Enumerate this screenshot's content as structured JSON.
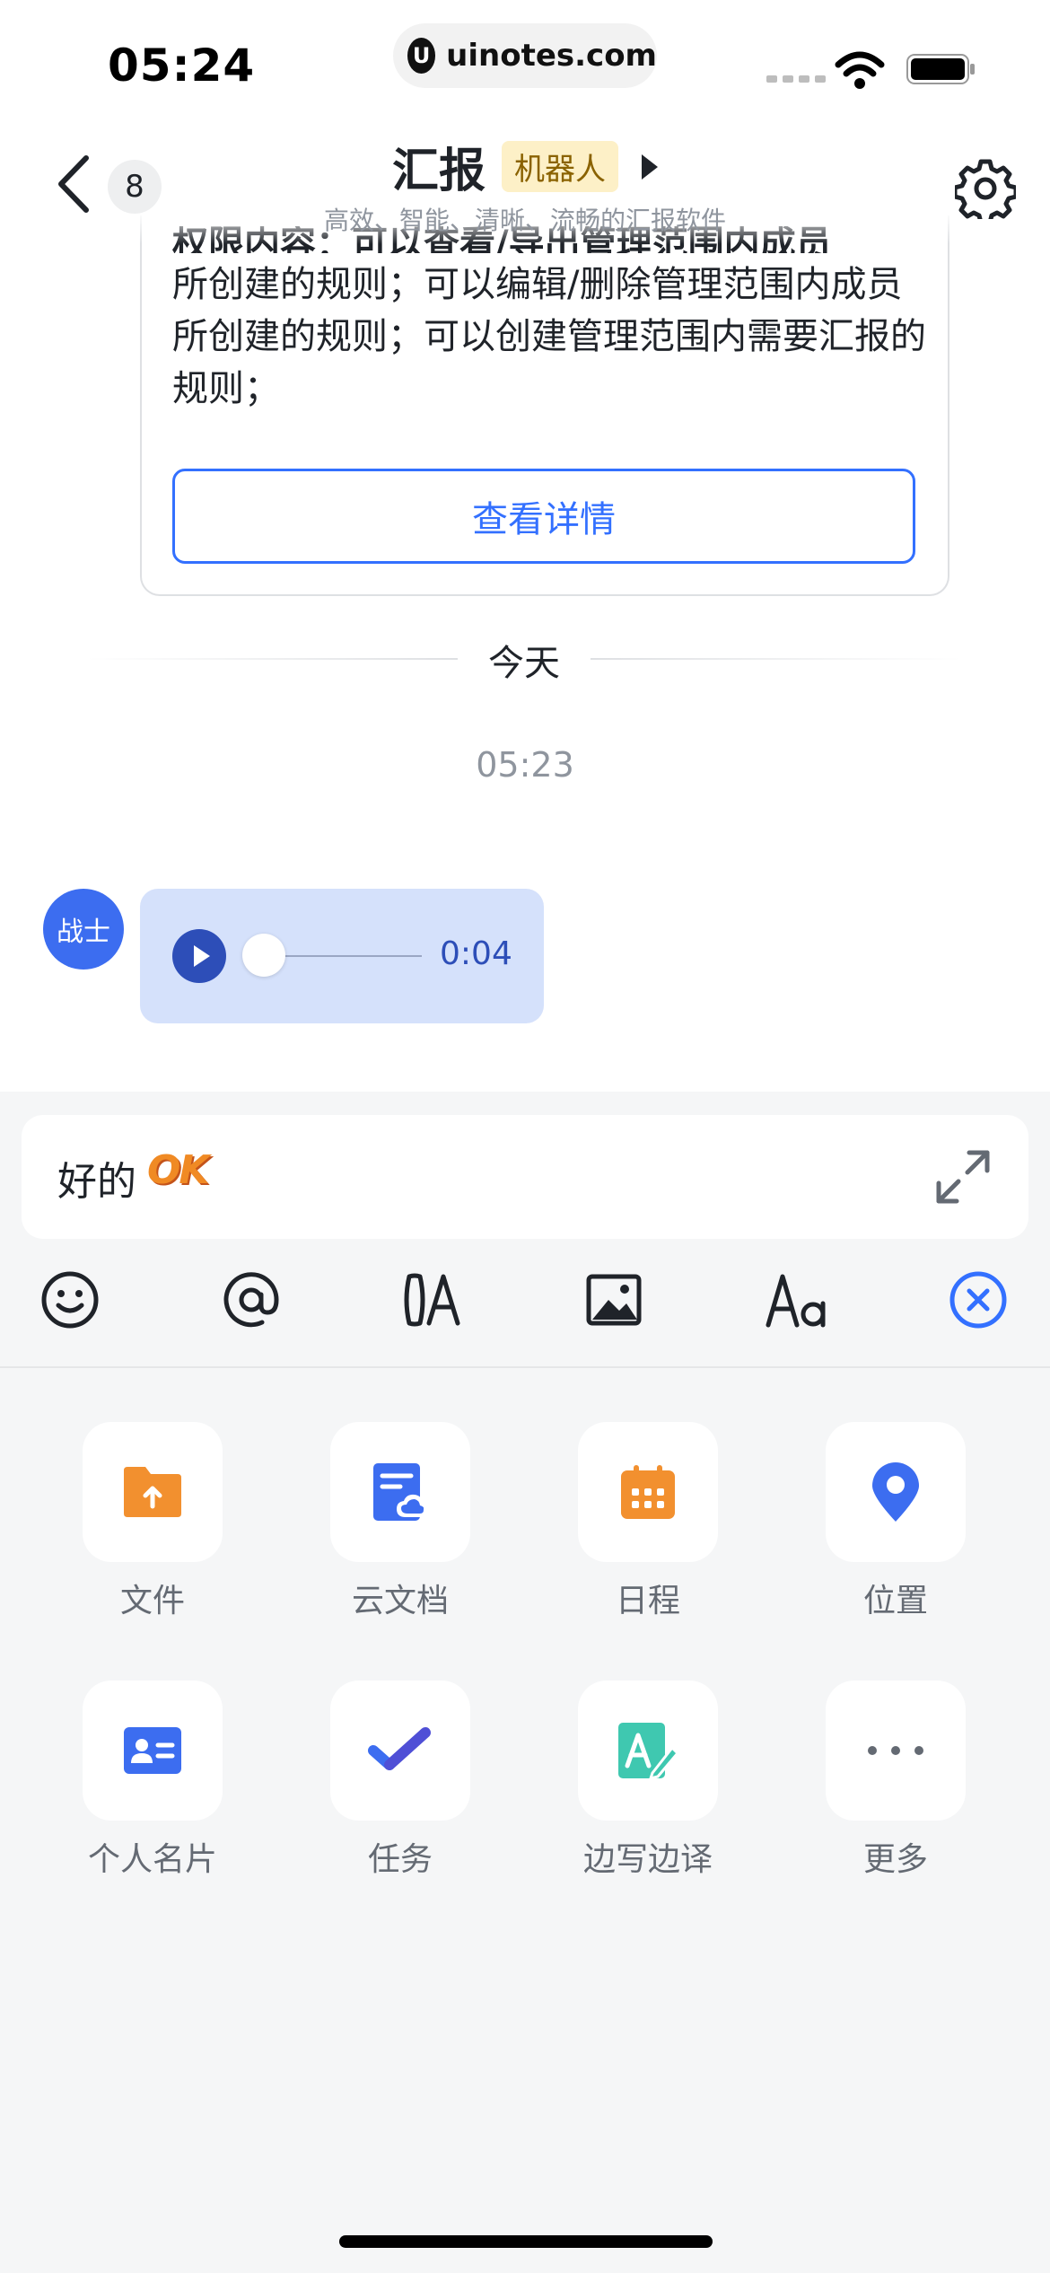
{
  "status_bar": {
    "time": "05:24",
    "url": "uinotes.com",
    "url_logo": "U"
  },
  "header": {
    "back_count": "8",
    "title": "汇报",
    "tag": "机器人",
    "subtitle": "高效、智能、清晰、流畅的汇报软件"
  },
  "message_card": {
    "cut_line": "权限内容：可以查看/导出管理范围内成员",
    "text": "所创建的规则；可以编辑/删除管理范围内成员所创建的规则；可以创建管理范围内需要汇报的规则；",
    "detail_button": "查看详情"
  },
  "timeline": {
    "date": "今天",
    "time": "05:23"
  },
  "voice_message": {
    "sender_avatar": "战士",
    "duration": "0:04",
    "progress": 0
  },
  "composer": {
    "text": "好的",
    "sticker": "OK"
  },
  "toolbar": {
    "icons": [
      "emoji-icon",
      "mention-icon",
      "translate-icon",
      "image-icon",
      "font-format-icon",
      "close-panel-icon"
    ],
    "accent": "#3370ff"
  },
  "panel": {
    "items": [
      {
        "label": "文件",
        "icon": "folder-upload-icon",
        "color": "#f2902f"
      },
      {
        "label": "云文档",
        "icon": "cloud-doc-icon",
        "color": "#3c6df0"
      },
      {
        "label": "日程",
        "icon": "calendar-icon",
        "color": "#f2902f"
      },
      {
        "label": "位置",
        "icon": "location-pin-icon",
        "color": "#3c6df0"
      },
      {
        "label": "个人名片",
        "icon": "contact-card-icon",
        "color": "#3c6df0"
      },
      {
        "label": "任务",
        "icon": "task-check-icon",
        "color": "#4f4fd6"
      },
      {
        "label": "边写边译",
        "icon": "write-translate-icon",
        "color": "#3fc8b0"
      },
      {
        "label": "更多",
        "icon": "more-dots-icon",
        "color": "#646a73"
      }
    ]
  }
}
